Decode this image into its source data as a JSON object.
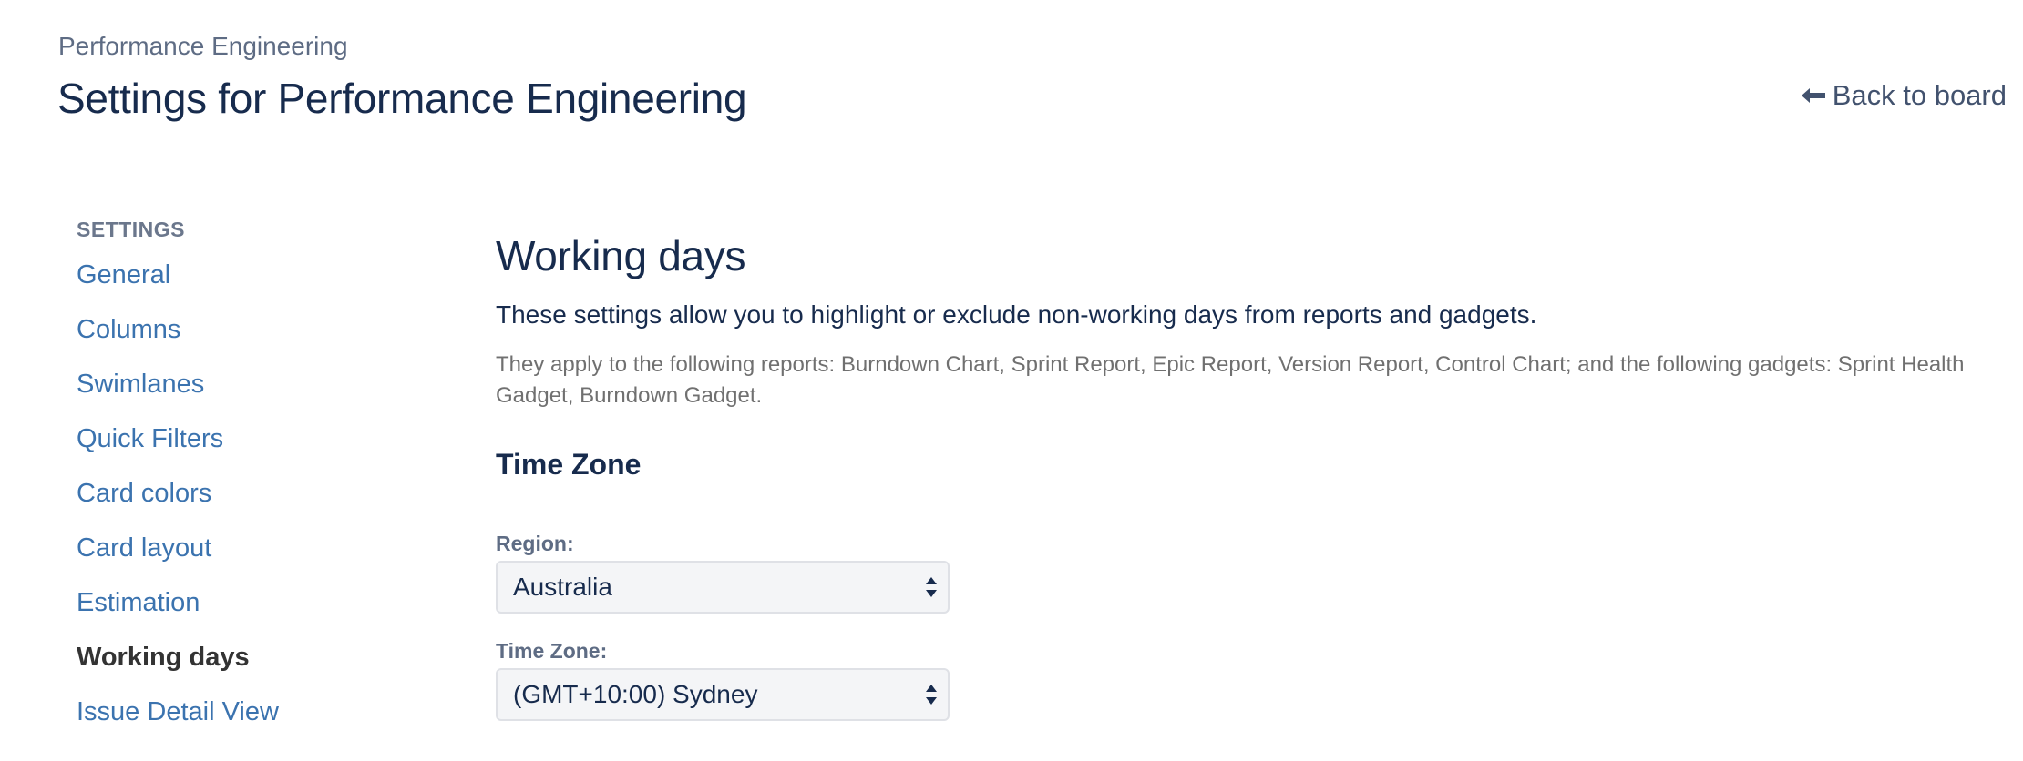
{
  "header": {
    "breadcrumb": "Performance Engineering",
    "title": "Settings for Performance Engineering",
    "back_link": "Back to board",
    "back_icon": "arrow-left-icon"
  },
  "sidebar": {
    "heading": "SETTINGS",
    "items": [
      {
        "label": "General",
        "active": false
      },
      {
        "label": "Columns",
        "active": false
      },
      {
        "label": "Swimlanes",
        "active": false
      },
      {
        "label": "Quick Filters",
        "active": false
      },
      {
        "label": "Card colors",
        "active": false
      },
      {
        "label": "Card layout",
        "active": false
      },
      {
        "label": "Estimation",
        "active": false
      },
      {
        "label": "Working days",
        "active": true
      },
      {
        "label": "Issue Detail View",
        "active": false
      }
    ]
  },
  "main": {
    "title": "Working days",
    "intro": "These settings allow you to highlight or exclude non-working days from reports and gadgets.",
    "note": "They apply to the following reports: Burndown Chart, Sprint Report, Epic Report, Version Report, Control Chart; and the following gadgets: Sprint Health Gadget, Burndown Gadget.",
    "time_zone_section": {
      "title": "Time Zone",
      "region_label": "Region:",
      "region_value": "Australia",
      "timezone_label": "Time Zone:",
      "timezone_value": "(GMT+10:00) Sydney"
    }
  },
  "colors": {
    "link": "#3b73af",
    "heading": "#172b4d",
    "muted": "#5e6c84",
    "active_item": "#333333",
    "select_bg": "#f4f5f7",
    "select_border": "#dfe1e6"
  }
}
